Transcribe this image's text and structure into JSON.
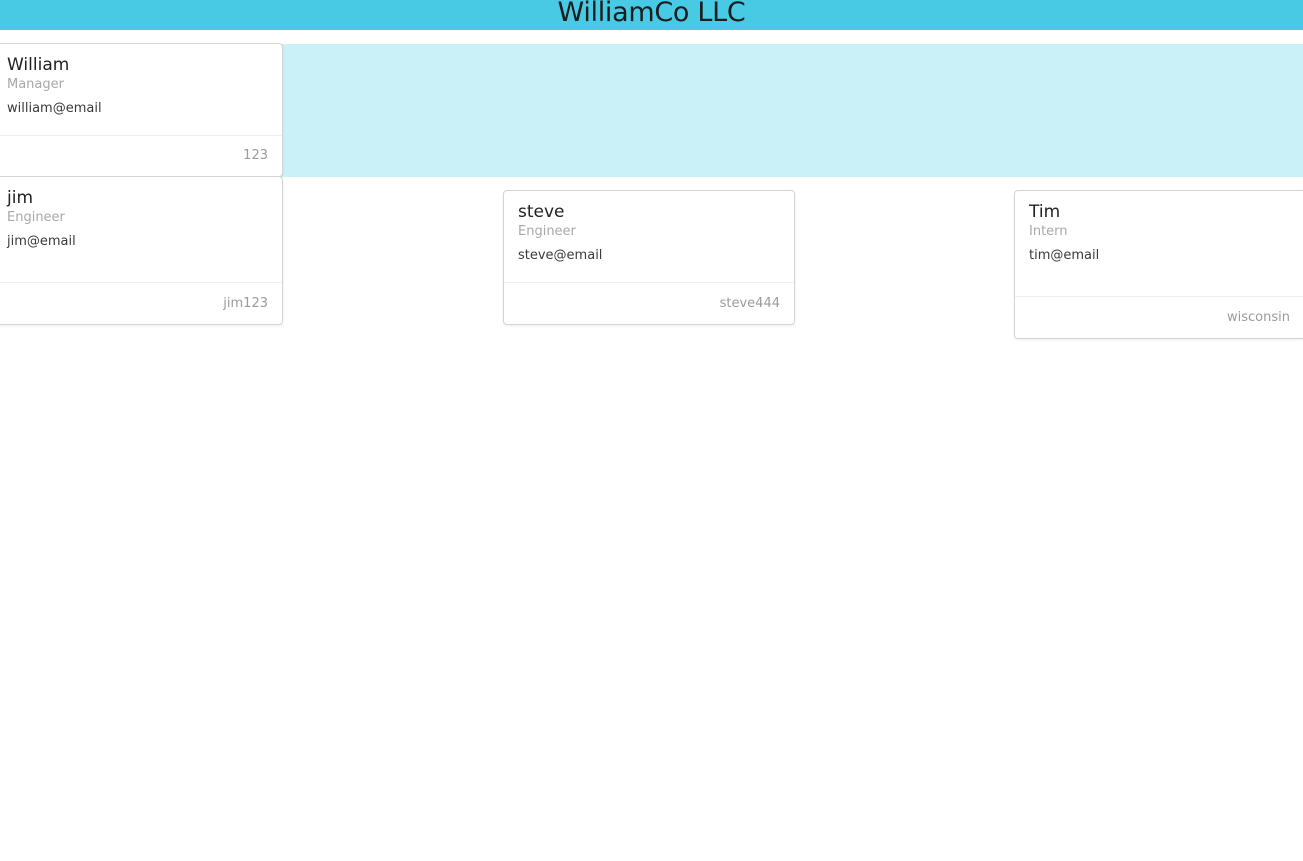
{
  "header": {
    "title": "WilliamCo LLC"
  },
  "colors": {
    "header_bg": "#48cae4",
    "band_bg": "#caf0f8"
  },
  "cards": [
    {
      "name": "William",
      "role": "Manager",
      "email": "william@email",
      "id": "123"
    },
    {
      "name": "jim",
      "role": "Engineer",
      "email": "jim@email",
      "id": "jim123"
    },
    {
      "name": "steve",
      "role": "Engineer",
      "email": "steve@email",
      "id": "steve444"
    },
    {
      "name": "Tim",
      "role": "Intern",
      "email": "tim@email",
      "id": "wisconsin"
    }
  ]
}
